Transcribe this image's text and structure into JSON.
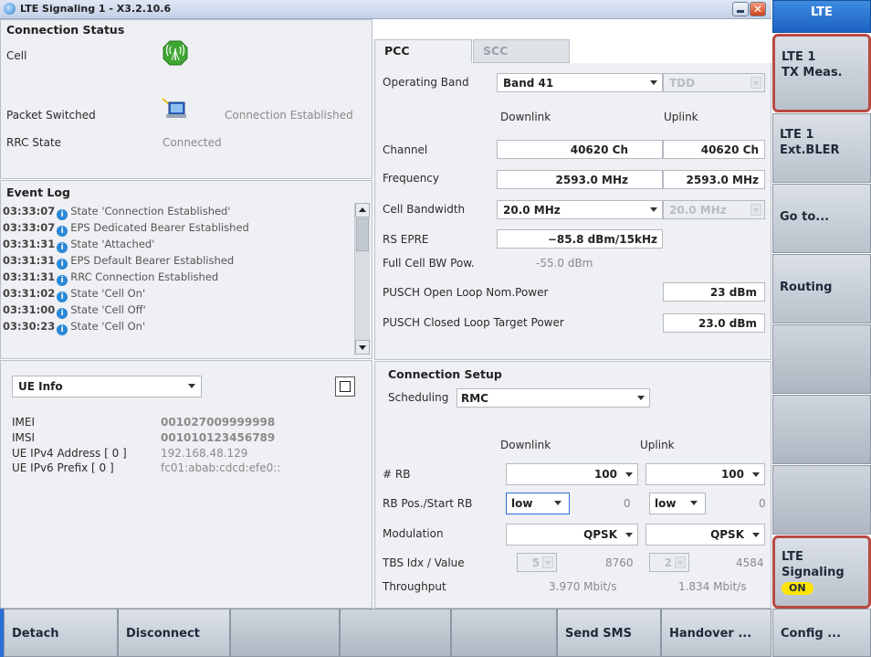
{
  "window": {
    "title": "LTE Signaling 1 - X3.2.10.6",
    "close_glyph": "✕"
  },
  "top_right_tab": "LTE",
  "connection_status": {
    "title": "Connection Status",
    "cell_label": "Cell",
    "ps_label": "Packet Switched",
    "ps_value": "Connection Established",
    "rrc_label": "RRC State",
    "rrc_value": "Connected"
  },
  "event_log": {
    "title": "Event Log",
    "entries": [
      {
        "time": "03:33:07",
        "text": "State 'Connection Established'"
      },
      {
        "time": "03:33:07",
        "text": "EPS Dedicated Bearer Established"
      },
      {
        "time": "03:31:31",
        "text": "State 'Attached'"
      },
      {
        "time": "03:31:31",
        "text": "EPS Default Bearer Established"
      },
      {
        "time": "03:31:31",
        "text": "RRC Connection Established"
      },
      {
        "time": "03:31:02",
        "text": "State 'Cell On'"
      },
      {
        "time": "03:31:00",
        "text": "State 'Cell Off'"
      },
      {
        "time": "03:30:23",
        "text": "State 'Cell On'"
      }
    ]
  },
  "ue_info": {
    "select_value": "UE Info",
    "rows": [
      {
        "label": "IMEI",
        "value": "001027009999998"
      },
      {
        "label": "IMSI",
        "value": "001010123456789"
      },
      {
        "label": "UE IPv4 Address [ 0 ]",
        "value": "192.168.48.129"
      },
      {
        "label": "UE IPv6 Prefix [ 0 ]",
        "value": "fc01:abab:cdcd:efe0::"
      }
    ]
  },
  "tabs": {
    "pcc": "PCC",
    "scc": "SCC"
  },
  "pcc": {
    "operating_band_label": "Operating Band",
    "operating_band_value": "Band 41",
    "duplex_value": "TDD",
    "downlink_header": "Downlink",
    "uplink_header": "Uplink",
    "channel_label": "Channel",
    "channel_dl": "40620 Ch",
    "channel_ul": "40620 Ch",
    "frequency_label": "Frequency",
    "frequency_dl": "2593.0 MHz",
    "frequency_ul": "2593.0 MHz",
    "cell_bw_label": "Cell Bandwidth",
    "cell_bw_dl": "20.0 MHz",
    "cell_bw_ul": "20.0 MHz",
    "rs_epre_label": "RS EPRE",
    "rs_epre_value": "−85.8 dBm/15kHz",
    "full_cell_bw_label": "Full Cell BW Pow.",
    "full_cell_bw_value": "-55.0 dBm",
    "pusch_open_label": "PUSCH Open Loop Nom.Power",
    "pusch_open_value": "23 dBm",
    "pusch_closed_label": "PUSCH Closed Loop Target Power",
    "pusch_closed_value": "23.0 dBm"
  },
  "connection_setup": {
    "title": "Connection Setup",
    "scheduling_label": "Scheduling",
    "scheduling_value": "RMC",
    "downlink_header": "Downlink",
    "uplink_header": "Uplink",
    "rb_label": "# RB",
    "rb_dl": "100",
    "rb_ul": "100",
    "rbpos_label": "RB Pos./Start RB",
    "rbpos_dl": "low",
    "rbpos_dl_start": "0",
    "rbpos_ul": "low",
    "rbpos_ul_start": "0",
    "modulation_label": "Modulation",
    "modulation_dl": "QPSK",
    "modulation_ul": "QPSK",
    "tbs_label": "TBS Idx / Value",
    "tbs_dl_idx": "5",
    "tbs_dl_value": "8760",
    "tbs_ul_idx": "2",
    "tbs_ul_value": "4584",
    "throughput_label": "Throughput",
    "throughput_dl": "3.970 Mbit/s",
    "throughput_ul": "1.834 Mbit/s"
  },
  "softkeys_right": {
    "k1a": "LTE 1",
    "k1b": "TX Meas.",
    "k2a": "LTE 1",
    "k2b": "Ext.BLER",
    "k3": "Go to...",
    "k4": "Routing",
    "k8a": "LTE",
    "k8b": "Signaling",
    "k8_badge": "ON"
  },
  "softkeys_bottom": {
    "detach": "Detach",
    "disconnect": "Disconnect",
    "send_sms": "Send SMS",
    "handover": "Handover ...",
    "config": "Config ..."
  }
}
